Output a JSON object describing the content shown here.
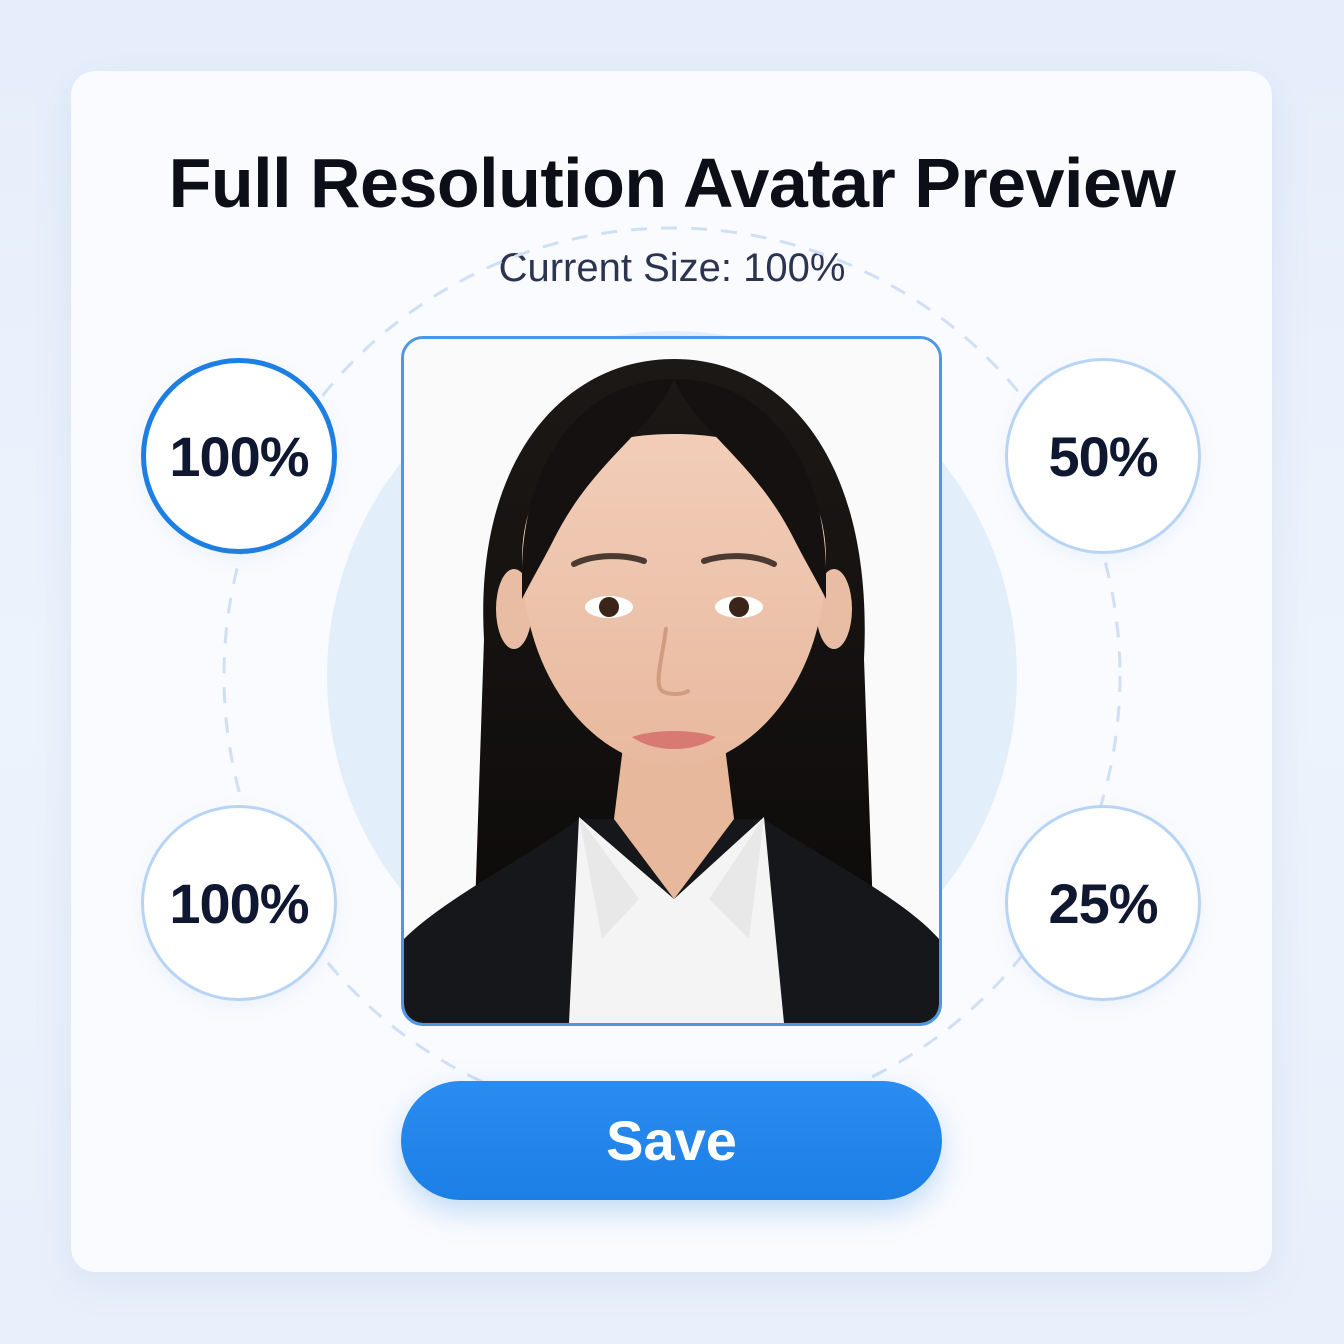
{
  "header": {
    "title": "Full Resolution Avatar Preview",
    "subtitle": "Current Size: 100%"
  },
  "zoom_options": [
    {
      "label": "100%",
      "selected": true
    },
    {
      "label": "50%",
      "selected": false
    },
    {
      "label": "100%",
      "selected": false
    },
    {
      "label": "25%",
      "selected": false
    }
  ],
  "preview": {
    "image_alt": "avatar photo"
  },
  "actions": {
    "save_label": "Save"
  },
  "colors": {
    "accent": "#1e7fe3",
    "ring_border": "#b8d4f5",
    "background": "#eaf1fb",
    "card": "#fafbfe"
  }
}
